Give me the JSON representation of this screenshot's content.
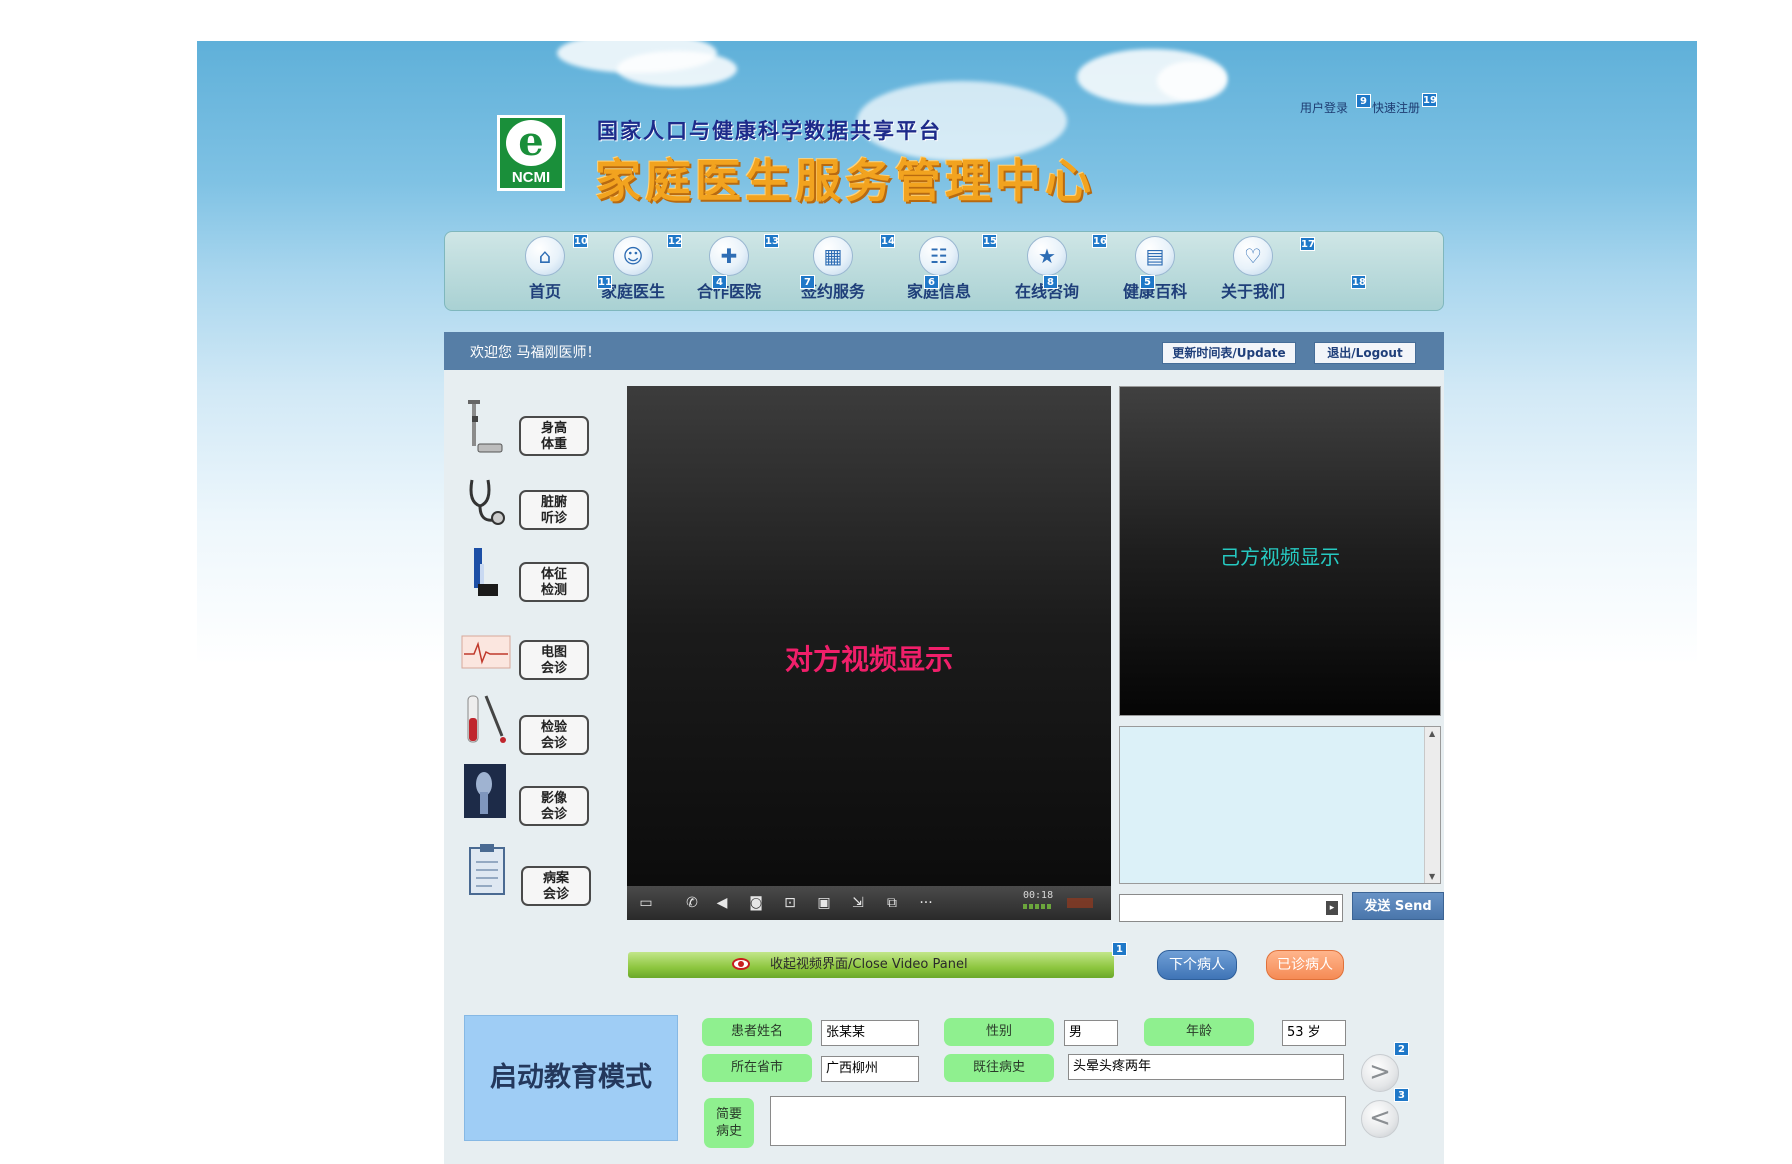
{
  "header": {
    "site_subtitle": "国家人口与健康科学数据共享平台",
    "site_title": "家庭医生服务管理中心",
    "logo_text": "NCMI",
    "user_login": "用户登录",
    "quick_register": "快速注册",
    "tags": {
      "login": "9",
      "register": "19"
    }
  },
  "nav": {
    "items": [
      {
        "label": "首页",
        "icon": "home-icon",
        "tag": "10"
      },
      {
        "label": "家庭医生",
        "icon": "doctor-icon",
        "tag": "12"
      },
      {
        "label": "合作医院",
        "icon": "hospital-icon",
        "tag": "13"
      },
      {
        "label": "签约服务",
        "icon": "calendar-icon",
        "tag": "14"
      },
      {
        "label": "家庭信息",
        "icon": "family-info-icon",
        "tag": "15"
      },
      {
        "label": "在线咨询",
        "icon": "star-consult-icon",
        "tag": "16"
      },
      {
        "label": "健康百科",
        "icon": "book-icon",
        "tag": "5"
      },
      {
        "label": "关于我们",
        "icon": "handshake-icon",
        "tag": "17"
      }
    ],
    "extra_tags": [
      "11",
      "4",
      "7",
      "6",
      "8",
      "18"
    ]
  },
  "welcome": {
    "text": "欢迎您   马福刚医师！",
    "update_button": "更新时间表/Update",
    "logout_button": "退出/Logout"
  },
  "tools": [
    {
      "label": "身高\n体重",
      "icon": "scale-icon"
    },
    {
      "label": "脏腑\n听诊",
      "icon": "stethoscope-icon"
    },
    {
      "label": "体征\n检测",
      "icon": "blood-pressure-icon"
    },
    {
      "label": "电图\n会诊",
      "icon": "ecg-icon"
    },
    {
      "label": "检验\n会诊",
      "icon": "test-tube-icon"
    },
    {
      "label": "影像\n会诊",
      "icon": "xray-icon"
    },
    {
      "label": "病案\n会诊",
      "icon": "clipboard-icon"
    }
  ],
  "video": {
    "remote_caption": "对方视频显示",
    "local_caption": "己方视频显示",
    "timer": "00:18",
    "controls": [
      "chat-icon",
      "mic-mute-icon",
      "speaker-mute-icon",
      "camera-icon",
      "screenshot-icon",
      "record-icon",
      "minimize-icon",
      "screen-share-icon",
      "more-icon"
    ]
  },
  "chat": {
    "send_button": "发送 Send"
  },
  "actions": {
    "close_video_panel": "收起视频界面/Close  Video  Panel",
    "close_tag": "1",
    "next_patient": "下个病人",
    "seen_patients": "已诊病人",
    "education_mode": "启动教育模式"
  },
  "patient": {
    "name_label": "患者姓名",
    "name_value": "张某某",
    "gender_label": "性别",
    "gender_value": "男",
    "age_label": "年龄",
    "age_value": "53 岁",
    "city_label": "所在省市",
    "city_value": "广西柳州",
    "history_label": "既往病史",
    "history_value": "头晕头疼两年",
    "brief_label": "简要\n病史",
    "brief_value": ""
  },
  "pager": {
    "next_symbol": ">",
    "prev_symbol": "<",
    "next_tag": "2",
    "prev_tag": "3"
  }
}
